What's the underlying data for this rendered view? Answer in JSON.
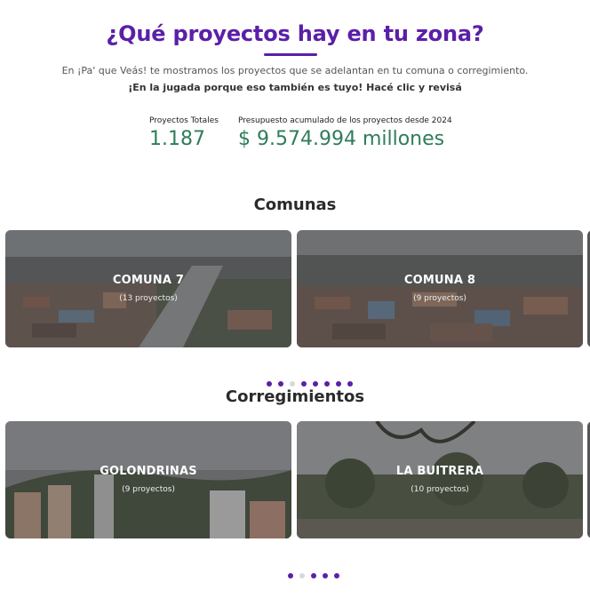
{
  "header": {
    "title": "¿Qué proyectos hay en tu zona?",
    "intro_line1": "En ¡Pa' que Veás! te mostramos los proyectos que se adelantan en tu comuna o corregimiento.",
    "intro_line2": "¡En la jugada porque eso también es tuyo! Hacé clic y revisá"
  },
  "stats": {
    "total_label": "Proyectos Totales",
    "total_value": "1.187",
    "budget_label": "Presupuesto acumulado de los proyectos desde 2024",
    "budget_value": "$ 9.574.994 millones"
  },
  "comunas": {
    "title": "Comunas",
    "cards": [
      {
        "name": "COMUNA 7",
        "count": "(13 proyectos)"
      },
      {
        "name": "COMUNA 8",
        "count": "(9 proyectos)"
      }
    ],
    "dots_total": 8,
    "dots_active_index": 2
  },
  "corregimientos": {
    "title": "Corregimientos",
    "cards": [
      {
        "name": "GOLONDRINAS",
        "count": "(9 proyectos)"
      },
      {
        "name": "LA BUITRERA",
        "count": "(10 proyectos)"
      }
    ],
    "dots_total": 5,
    "dots_active_index": 1
  },
  "colors": {
    "accent": "#5b1fa8",
    "value_green": "#2e7d5b",
    "inactive_dot": "#d9d9d9"
  }
}
